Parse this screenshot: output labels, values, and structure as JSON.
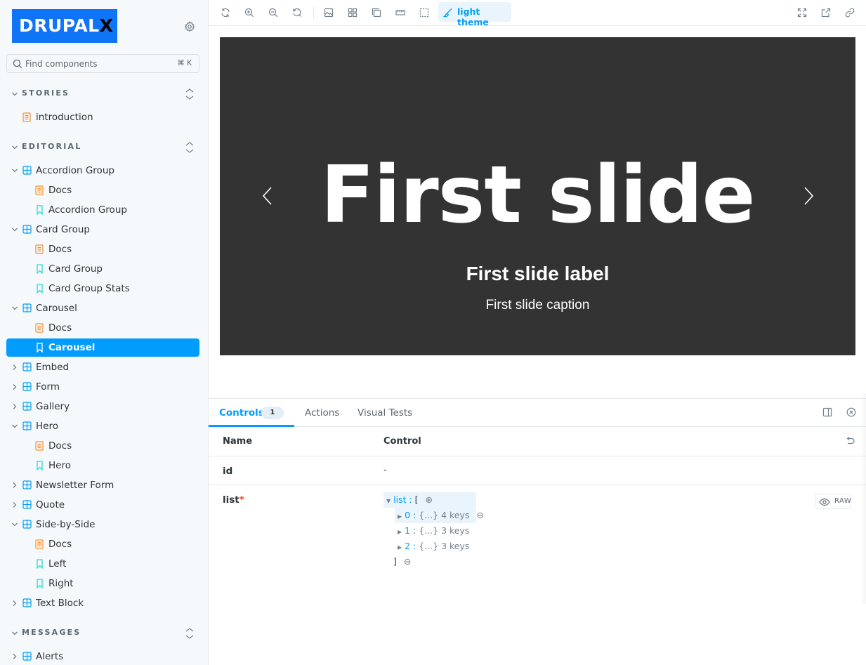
{
  "sidebar": {
    "logo_text": "DRUPAL",
    "logo_x": "X",
    "search_placeholder": "Find components",
    "search_shortcut": "⌘ K",
    "sections": [
      {
        "label": "STORIES"
      },
      {
        "label": "EDITORIAL"
      },
      {
        "label": "MESSAGES"
      }
    ],
    "items": [
      {
        "label": "introduction"
      },
      {
        "label": "Accordion Group"
      },
      {
        "label": "Docs"
      },
      {
        "label": "Accordion Group"
      },
      {
        "label": "Card Group"
      },
      {
        "label": "Docs"
      },
      {
        "label": "Card Group"
      },
      {
        "label": "Card Group Stats"
      },
      {
        "label": "Carousel"
      },
      {
        "label": "Docs"
      },
      {
        "label": "Carousel"
      },
      {
        "label": "Embed"
      },
      {
        "label": "Form"
      },
      {
        "label": "Gallery"
      },
      {
        "label": "Hero"
      },
      {
        "label": "Docs"
      },
      {
        "label": "Hero"
      },
      {
        "label": "Newsletter Form"
      },
      {
        "label": "Quote"
      },
      {
        "label": "Side-by-Side"
      },
      {
        "label": "Docs"
      },
      {
        "label": "Left"
      },
      {
        "label": "Right"
      },
      {
        "label": "Text Block"
      },
      {
        "label": "Alerts"
      }
    ]
  },
  "toolbar": {
    "theme_label": "light theme"
  },
  "preview": {
    "slide_title": "First slide",
    "slide_label": "First slide label",
    "slide_caption": "First slide caption"
  },
  "panel": {
    "tabs": [
      {
        "label": "Controls",
        "badge": "1"
      },
      {
        "label": "Actions"
      },
      {
        "label": "Visual Tests"
      }
    ],
    "header_name": "Name",
    "header_control": "Control",
    "rows": [
      {
        "name": "id",
        "value": "-"
      },
      {
        "name": "list",
        "required_mark": "*"
      }
    ],
    "json": {
      "root_key": "list :",
      "root_open": "[",
      "entries": [
        {
          "key": "0 :",
          "summary": "{...}",
          "count": "4 keys"
        },
        {
          "key": "1 :",
          "summary": "{...}",
          "count": "3 keys"
        },
        {
          "key": "2 :",
          "summary": "{...}",
          "count": "3 keys"
        }
      ],
      "root_close": "]"
    },
    "raw_label": "RAW"
  },
  "colors": {
    "accent": "#029cfd",
    "logo_bg": "#0f74f5",
    "carousel_bg": "#333333",
    "story_icon": "#37d5d3",
    "docs_icon": "#f68f2f",
    "component_icon": "#029cfd"
  }
}
